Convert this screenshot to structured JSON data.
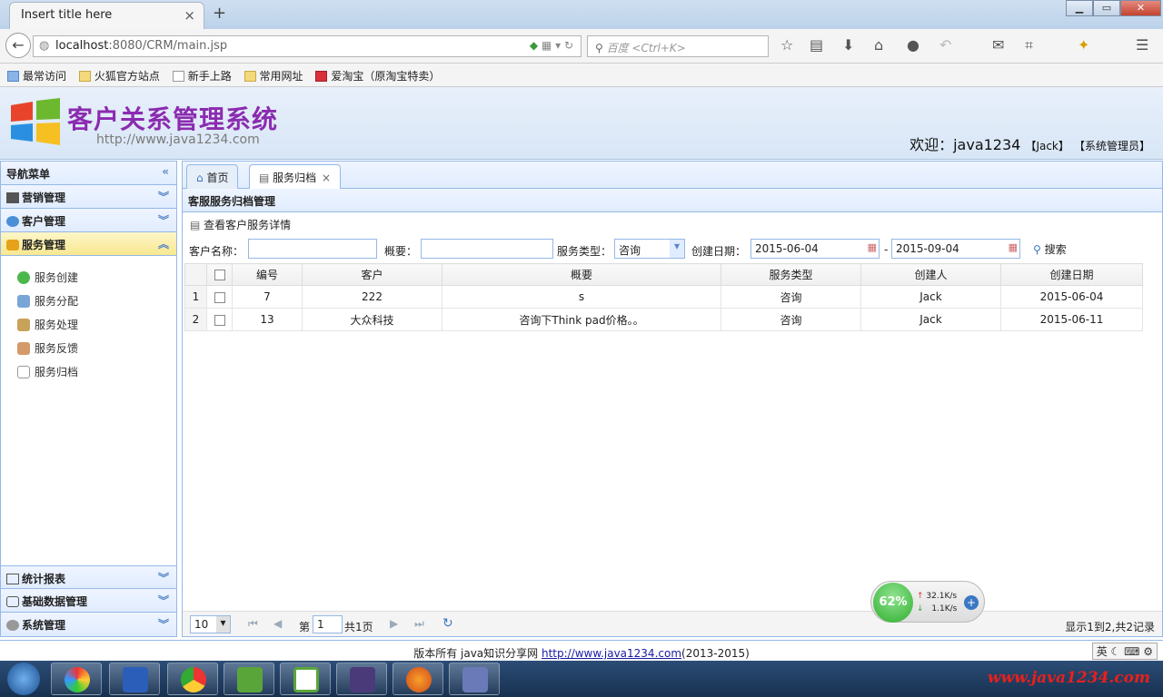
{
  "browser": {
    "tab_title": "Insert title here",
    "tab_close": "×",
    "new_tab": "+",
    "url_host": "localhost",
    "url_rest": ":8080/CRM/main.jsp",
    "search_placeholder": "百度 <Ctrl+K>",
    "bookmarks": [
      "最常访问",
      "火狐官方站点",
      "新手上路",
      "常用网址",
      "爱淘宝（原淘宝特卖）"
    ]
  },
  "header": {
    "title": "客户关系管理系统",
    "url": "http://www.java1234.com",
    "welcome": "欢迎：java1234",
    "user": "【Jack】",
    "role": "【系统管理员】"
  },
  "sidebar": {
    "title": "导航菜单",
    "groups": [
      "营销管理",
      "客户管理",
      "服务管理"
    ],
    "items": [
      "服务创建",
      "服务分配",
      "服务处理",
      "服务反馈",
      "服务归档"
    ],
    "bottom_groups": [
      "统计报表",
      "基础数据管理",
      "系统管理"
    ]
  },
  "main": {
    "tabs": [
      "首页",
      "服务归档"
    ],
    "panel_title": "客服服务归档管理",
    "view_detail": "查看客户服务详情",
    "filters": {
      "customer_label": "客户名称：",
      "customer_value": "",
      "summary_label": "概要：",
      "summary_value": "",
      "type_label": "服务类型：",
      "type_value": "咨询",
      "date_label": "创建日期：",
      "date_from": "2015-06-04",
      "date_sep": "-",
      "date_to": "2015-09-04",
      "search_label": "搜索"
    },
    "columns": [
      "编号",
      "客户",
      "概要",
      "服务类型",
      "创建人",
      "创建日期"
    ],
    "rows": [
      {
        "rn": "1",
        "id": "7",
        "customer": "222",
        "summary": "s",
        "type": "咨询",
        "creator": "Jack",
        "date": "2015-06-04"
      },
      {
        "rn": "2",
        "id": "13",
        "customer": "大众科技",
        "summary": "咨询下Think pad价格。。",
        "type": "咨询",
        "creator": "Jack",
        "date": "2015-06-11"
      }
    ],
    "pager": {
      "page_size": "10",
      "page_prefix": "第",
      "page_value": "1",
      "page_total": "共1页",
      "summary": "显示1到2,共2记录"
    }
  },
  "footer": {
    "text": "版本所有 java知识分享网 ",
    "link": "http://www.java1234.com",
    "years": "(2013-2015)",
    "ime": "英"
  },
  "net_widget": {
    "percent": "62%",
    "up": "32.1K/s",
    "down": "1.1K/s"
  },
  "watermark": "www.java1234.com",
  "colors": {
    "title_purple": "#8b2bb0",
    "panel_border": "#95b8e7",
    "active_group": "#f8e88f"
  }
}
